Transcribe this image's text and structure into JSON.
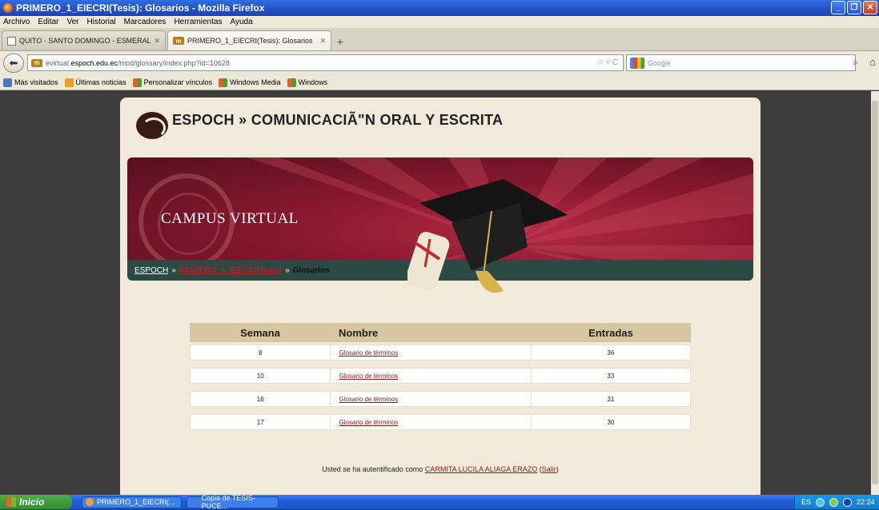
{
  "window": {
    "title": "PRIMERO_1_EIECRI(Tesis): Glosarios - Mozilla Firefox"
  },
  "menu": [
    "Archivo",
    "Editar",
    "Ver",
    "Historial",
    "Marcadores",
    "Herramientas",
    "Ayuda"
  ],
  "tabs": [
    {
      "label": "QUITO - SANTO DOMINGO - ESMERALDA...",
      "active": false
    },
    {
      "label": "PRIMERO_1_EIECRI(Tesis): Glosarios",
      "active": true
    }
  ],
  "nav": {
    "url_prefix": "evirtual.",
    "url_host": "espoch.edu.ec",
    "url_path": "/mod/glossary/index.php?id=10628",
    "search_placeholder": "Google"
  },
  "bookmarks": [
    "Más visitados",
    "Últimas noticias",
    "Personalizar vínculos",
    "Windows Media",
    "Windows"
  ],
  "page": {
    "site_title": "ESPOCH » COMUNICACIÃ\"N ORAL Y ESCRITA",
    "campus_label": "CAMPUS VIRTUAL",
    "breadcrumb": {
      "home": "ESPOCH",
      "sep": "»",
      "course": "PRIMERO_1_EIECRI(Tesis)",
      "current": "Glosarios"
    },
    "table": {
      "headers": [
        "Semana",
        "Nombre",
        "Entradas"
      ],
      "rows": [
        {
          "week": "8",
          "name": "Glosario de términos",
          "entries": "36"
        },
        {
          "week": "10",
          "name": "Glosario de términos",
          "entries": "33"
        },
        {
          "week": "16",
          "name": "Glosario de términos",
          "entries": "31"
        },
        {
          "week": "17",
          "name": "Glosario de términos",
          "entries": "30"
        }
      ]
    },
    "login": {
      "prefix": "Usted se ha autentificado como",
      "user": "CARMITA LUCILA ALIAGA ERAZO",
      "logout_open": "(",
      "logout": "Salir",
      "logout_close": ")"
    }
  },
  "taskbar": {
    "start": "Inicio",
    "items": [
      "PRIMERO_1_EIECRI(...",
      "Copia de TESIS-PUCE..."
    ],
    "lang": "ES",
    "time": "22:24"
  }
}
